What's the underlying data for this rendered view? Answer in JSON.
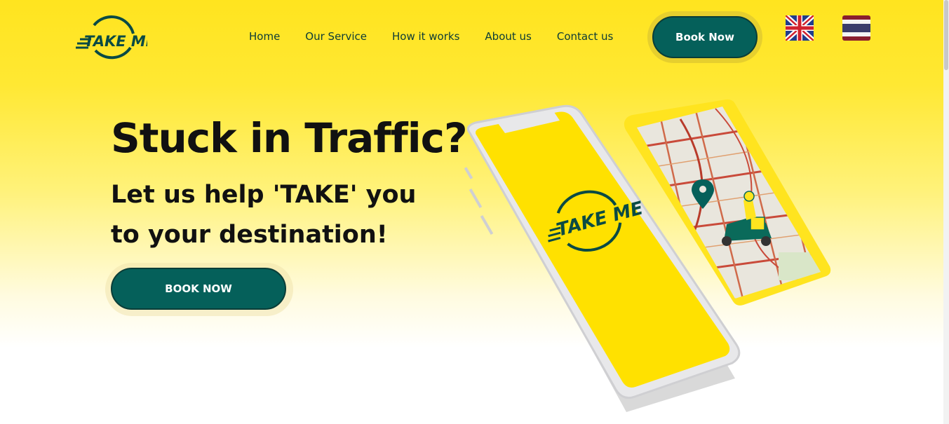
{
  "brand": {
    "logo_text": "TAKE ME"
  },
  "nav": {
    "items": [
      {
        "label": "Home"
      },
      {
        "label": "Our Service"
      },
      {
        "label": "How it works"
      },
      {
        "label": "About us"
      },
      {
        "label": "Contact us"
      }
    ],
    "book_label": "Book Now"
  },
  "languages": [
    {
      "flag": "uk-flag-icon"
    },
    {
      "flag": "thailand-flag-icon"
    }
  ],
  "hero": {
    "title": "Stuck in Traffic?",
    "subtitle": "Let us help 'TAKE' you to your destination!",
    "cta_label": "BOOK NOW"
  },
  "colors": {
    "brand_yellow": "#ffe41f",
    "brand_green": "#05605a",
    "text_dark": "#0b3b36"
  }
}
